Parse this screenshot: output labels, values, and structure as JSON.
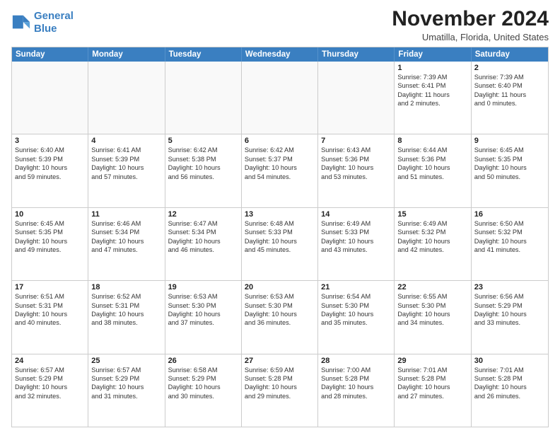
{
  "logo": {
    "line1": "General",
    "line2": "Blue"
  },
  "title": "November 2024",
  "subtitle": "Umatilla, Florida, United States",
  "header_days": [
    "Sunday",
    "Monday",
    "Tuesday",
    "Wednesday",
    "Thursday",
    "Friday",
    "Saturday"
  ],
  "rows": [
    [
      {
        "day": "",
        "lines": [],
        "empty": true
      },
      {
        "day": "",
        "lines": [],
        "empty": true
      },
      {
        "day": "",
        "lines": [],
        "empty": true
      },
      {
        "day": "",
        "lines": [],
        "empty": true
      },
      {
        "day": "",
        "lines": [],
        "empty": true
      },
      {
        "day": "1",
        "lines": [
          "Sunrise: 7:39 AM",
          "Sunset: 6:41 PM",
          "Daylight: 11 hours",
          "and 2 minutes."
        ],
        "empty": false
      },
      {
        "day": "2",
        "lines": [
          "Sunrise: 7:39 AM",
          "Sunset: 6:40 PM",
          "Daylight: 11 hours",
          "and 0 minutes."
        ],
        "empty": false
      }
    ],
    [
      {
        "day": "3",
        "lines": [
          "Sunrise: 6:40 AM",
          "Sunset: 5:39 PM",
          "Daylight: 10 hours",
          "and 59 minutes."
        ],
        "empty": false
      },
      {
        "day": "4",
        "lines": [
          "Sunrise: 6:41 AM",
          "Sunset: 5:39 PM",
          "Daylight: 10 hours",
          "and 57 minutes."
        ],
        "empty": false
      },
      {
        "day": "5",
        "lines": [
          "Sunrise: 6:42 AM",
          "Sunset: 5:38 PM",
          "Daylight: 10 hours",
          "and 56 minutes."
        ],
        "empty": false
      },
      {
        "day": "6",
        "lines": [
          "Sunrise: 6:42 AM",
          "Sunset: 5:37 PM",
          "Daylight: 10 hours",
          "and 54 minutes."
        ],
        "empty": false
      },
      {
        "day": "7",
        "lines": [
          "Sunrise: 6:43 AM",
          "Sunset: 5:36 PM",
          "Daylight: 10 hours",
          "and 53 minutes."
        ],
        "empty": false
      },
      {
        "day": "8",
        "lines": [
          "Sunrise: 6:44 AM",
          "Sunset: 5:36 PM",
          "Daylight: 10 hours",
          "and 51 minutes."
        ],
        "empty": false
      },
      {
        "day": "9",
        "lines": [
          "Sunrise: 6:45 AM",
          "Sunset: 5:35 PM",
          "Daylight: 10 hours",
          "and 50 minutes."
        ],
        "empty": false
      }
    ],
    [
      {
        "day": "10",
        "lines": [
          "Sunrise: 6:45 AM",
          "Sunset: 5:35 PM",
          "Daylight: 10 hours",
          "and 49 minutes."
        ],
        "empty": false
      },
      {
        "day": "11",
        "lines": [
          "Sunrise: 6:46 AM",
          "Sunset: 5:34 PM",
          "Daylight: 10 hours",
          "and 47 minutes."
        ],
        "empty": false
      },
      {
        "day": "12",
        "lines": [
          "Sunrise: 6:47 AM",
          "Sunset: 5:34 PM",
          "Daylight: 10 hours",
          "and 46 minutes."
        ],
        "empty": false
      },
      {
        "day": "13",
        "lines": [
          "Sunrise: 6:48 AM",
          "Sunset: 5:33 PM",
          "Daylight: 10 hours",
          "and 45 minutes."
        ],
        "empty": false
      },
      {
        "day": "14",
        "lines": [
          "Sunrise: 6:49 AM",
          "Sunset: 5:33 PM",
          "Daylight: 10 hours",
          "and 43 minutes."
        ],
        "empty": false
      },
      {
        "day": "15",
        "lines": [
          "Sunrise: 6:49 AM",
          "Sunset: 5:32 PM",
          "Daylight: 10 hours",
          "and 42 minutes."
        ],
        "empty": false
      },
      {
        "day": "16",
        "lines": [
          "Sunrise: 6:50 AM",
          "Sunset: 5:32 PM",
          "Daylight: 10 hours",
          "and 41 minutes."
        ],
        "empty": false
      }
    ],
    [
      {
        "day": "17",
        "lines": [
          "Sunrise: 6:51 AM",
          "Sunset: 5:31 PM",
          "Daylight: 10 hours",
          "and 40 minutes."
        ],
        "empty": false
      },
      {
        "day": "18",
        "lines": [
          "Sunrise: 6:52 AM",
          "Sunset: 5:31 PM",
          "Daylight: 10 hours",
          "and 38 minutes."
        ],
        "empty": false
      },
      {
        "day": "19",
        "lines": [
          "Sunrise: 6:53 AM",
          "Sunset: 5:30 PM",
          "Daylight: 10 hours",
          "and 37 minutes."
        ],
        "empty": false
      },
      {
        "day": "20",
        "lines": [
          "Sunrise: 6:53 AM",
          "Sunset: 5:30 PM",
          "Daylight: 10 hours",
          "and 36 minutes."
        ],
        "empty": false
      },
      {
        "day": "21",
        "lines": [
          "Sunrise: 6:54 AM",
          "Sunset: 5:30 PM",
          "Daylight: 10 hours",
          "and 35 minutes."
        ],
        "empty": false
      },
      {
        "day": "22",
        "lines": [
          "Sunrise: 6:55 AM",
          "Sunset: 5:30 PM",
          "Daylight: 10 hours",
          "and 34 minutes."
        ],
        "empty": false
      },
      {
        "day": "23",
        "lines": [
          "Sunrise: 6:56 AM",
          "Sunset: 5:29 PM",
          "Daylight: 10 hours",
          "and 33 minutes."
        ],
        "empty": false
      }
    ],
    [
      {
        "day": "24",
        "lines": [
          "Sunrise: 6:57 AM",
          "Sunset: 5:29 PM",
          "Daylight: 10 hours",
          "and 32 minutes."
        ],
        "empty": false
      },
      {
        "day": "25",
        "lines": [
          "Sunrise: 6:57 AM",
          "Sunset: 5:29 PM",
          "Daylight: 10 hours",
          "and 31 minutes."
        ],
        "empty": false
      },
      {
        "day": "26",
        "lines": [
          "Sunrise: 6:58 AM",
          "Sunset: 5:29 PM",
          "Daylight: 10 hours",
          "and 30 minutes."
        ],
        "empty": false
      },
      {
        "day": "27",
        "lines": [
          "Sunrise: 6:59 AM",
          "Sunset: 5:28 PM",
          "Daylight: 10 hours",
          "and 29 minutes."
        ],
        "empty": false
      },
      {
        "day": "28",
        "lines": [
          "Sunrise: 7:00 AM",
          "Sunset: 5:28 PM",
          "Daylight: 10 hours",
          "and 28 minutes."
        ],
        "empty": false
      },
      {
        "day": "29",
        "lines": [
          "Sunrise: 7:01 AM",
          "Sunset: 5:28 PM",
          "Daylight: 10 hours",
          "and 27 minutes."
        ],
        "empty": false
      },
      {
        "day": "30",
        "lines": [
          "Sunrise: 7:01 AM",
          "Sunset: 5:28 PM",
          "Daylight: 10 hours",
          "and 26 minutes."
        ],
        "empty": false
      }
    ]
  ]
}
